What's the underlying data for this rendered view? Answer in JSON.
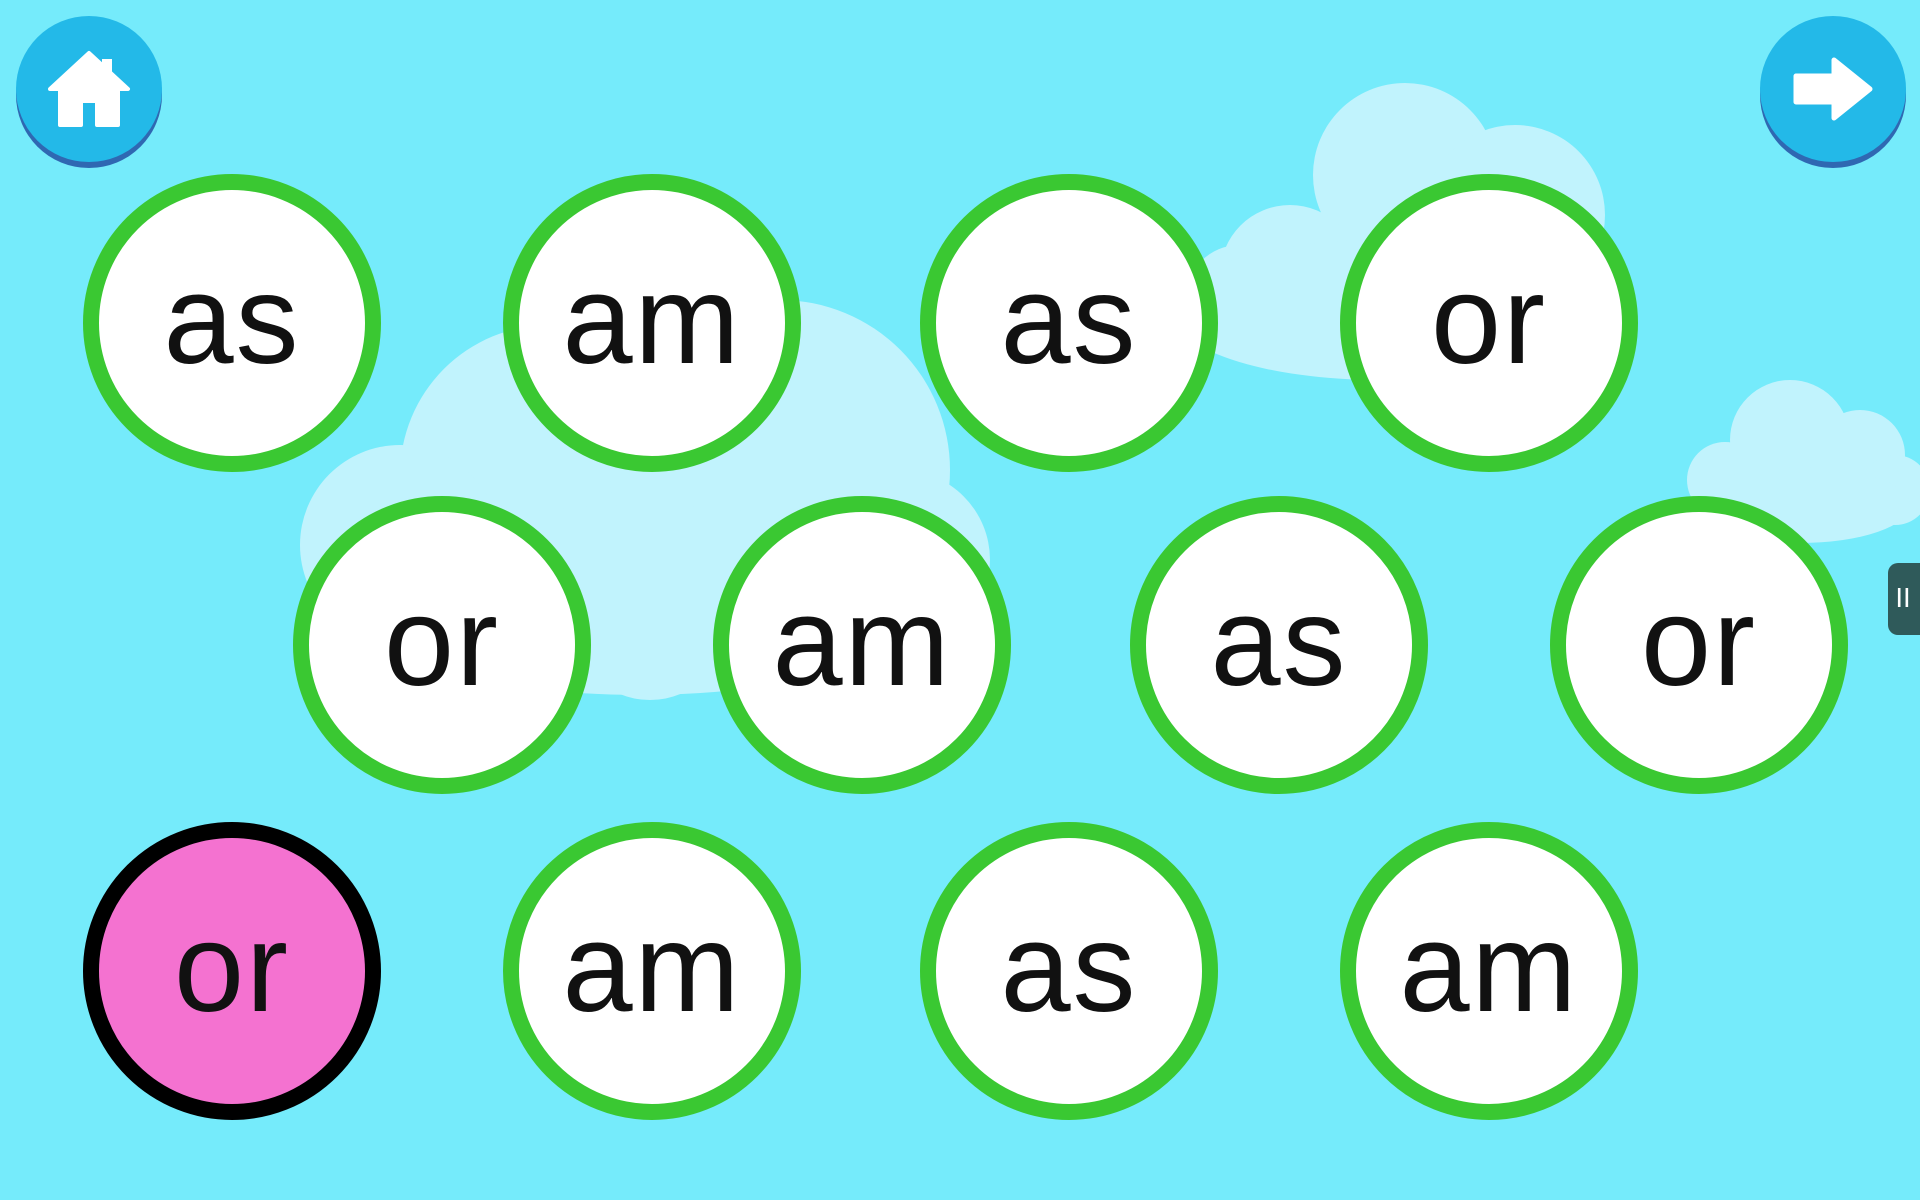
{
  "colors": {
    "sky": "#75ebfb",
    "cloud": "#c1f3fd",
    "nav_button": "#23b9e8",
    "nav_icon": "#ffffff",
    "bubble_fill": "#ffffff",
    "bubble_border": "#3ac832",
    "selected_fill": "#f472d0",
    "selected_border": "#000000",
    "word_text": "#111111",
    "side_handle": "#2f5a5a"
  },
  "toolbar": {
    "home_icon": "home-icon",
    "next_icon": "arrow-right-icon"
  },
  "words": [
    {
      "text": "as",
      "selected": false
    },
    {
      "text": "am",
      "selected": false
    },
    {
      "text": "as",
      "selected": false
    },
    {
      "text": "or",
      "selected": false
    },
    {
      "text": "or",
      "selected": false
    },
    {
      "text": "am",
      "selected": false
    },
    {
      "text": "as",
      "selected": false
    },
    {
      "text": "or",
      "selected": false
    },
    {
      "text": "or",
      "selected": true
    },
    {
      "text": "am",
      "selected": false
    },
    {
      "text": "as",
      "selected": false
    },
    {
      "text": "am",
      "selected": false
    }
  ],
  "side_handle": {
    "icon": "pause-grip-icon",
    "glyph": "II"
  }
}
